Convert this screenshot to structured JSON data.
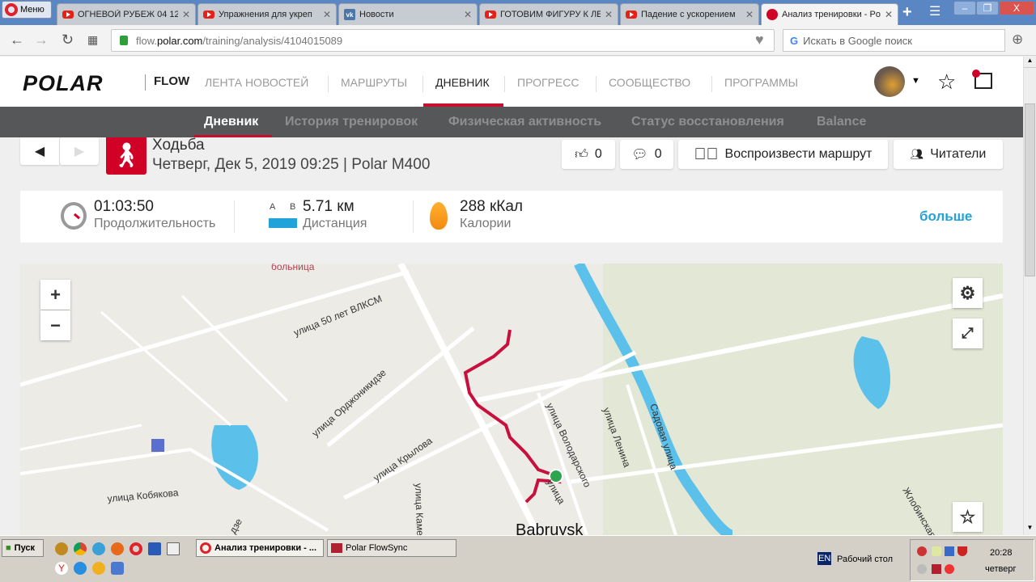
{
  "browser": {
    "menu_label": "Меню",
    "tabs": [
      {
        "title": "ОГНЕВОЙ РУБЕЖ 04 12",
        "icon": "youtube-icon"
      },
      {
        "title": "Упражнения для укреп",
        "icon": "youtube-icon"
      },
      {
        "title": "Новости",
        "icon": "vk-icon"
      },
      {
        "title": "ГОТОВИМ ФИГУРУ К ЛЕ",
        "icon": "youtube-icon"
      },
      {
        "title": "Падение с ускорением",
        "icon": "youtube-icon"
      },
      {
        "title": "Анализ тренировки - Po",
        "icon": "polar-icon",
        "active": true
      }
    ],
    "url_prefix": "flow.",
    "url_domain": "polar.com",
    "url_path": "/training/analysis/4104015089",
    "search_placeholder": "Искать в Google поиск"
  },
  "header": {
    "brand": "POLAR",
    "product": "FLOW",
    "nav": [
      "ЛЕНТА НОВОСТЕЙ",
      "МАРШРУТЫ",
      "ДНЕВНИК",
      "ПРОГРЕСС",
      "СООБЩЕСТВО",
      "ПРОГРАММЫ"
    ],
    "active_nav": "ДНЕВНИК"
  },
  "subnav": {
    "items": [
      "Дневник",
      "История тренировок",
      "Физическая активность",
      "Статус восстановления",
      "Balance"
    ],
    "active": "Дневник"
  },
  "activity": {
    "sport": "Ходьба",
    "details": "Четверг, Дек 5, 2019 09:25 | Polar M400",
    "likes": "0",
    "comments": "0",
    "replay_label": "Воспроизвести маршрут",
    "followers_label": "Читатели"
  },
  "stats": {
    "duration_value": "01:03:50",
    "duration_label": "Продолжительность",
    "distance_a": "A",
    "distance_b": "B",
    "distance_value": "5.71 км",
    "distance_label": "Дистанция",
    "calories_value": "288 кКал",
    "calories_label": "Калории",
    "more_label": "больше"
  },
  "map": {
    "zoom_in": "+",
    "zoom_out": "−",
    "labels": {
      "hospital": "больница",
      "vlksm": "улица 50 лет ВЛКСМ",
      "ordzh": "улица Орджоникидзе",
      "krylova": "улица Крылова",
      "kobyakova": "улица Кобякова",
      "volodarskogo": "улица Володарского",
      "lenina": "улица Ленина",
      "sadovaya": "Садовая улица",
      "zhlobinskaya": "Жлобинская",
      "kamen": "улица Камен",
      "ulitsa": "улица",
      "city": "Babruysk",
      "dze": "дзе"
    },
    "route_color": "#c8103e"
  },
  "taskbar": {
    "start": "Пуск",
    "tasks": [
      "Анализ тренировки - ...",
      "Polar FlowSync"
    ],
    "lang": "EN",
    "desktop": "Рабочий стол",
    "time": "20:28",
    "day": "четверг"
  }
}
